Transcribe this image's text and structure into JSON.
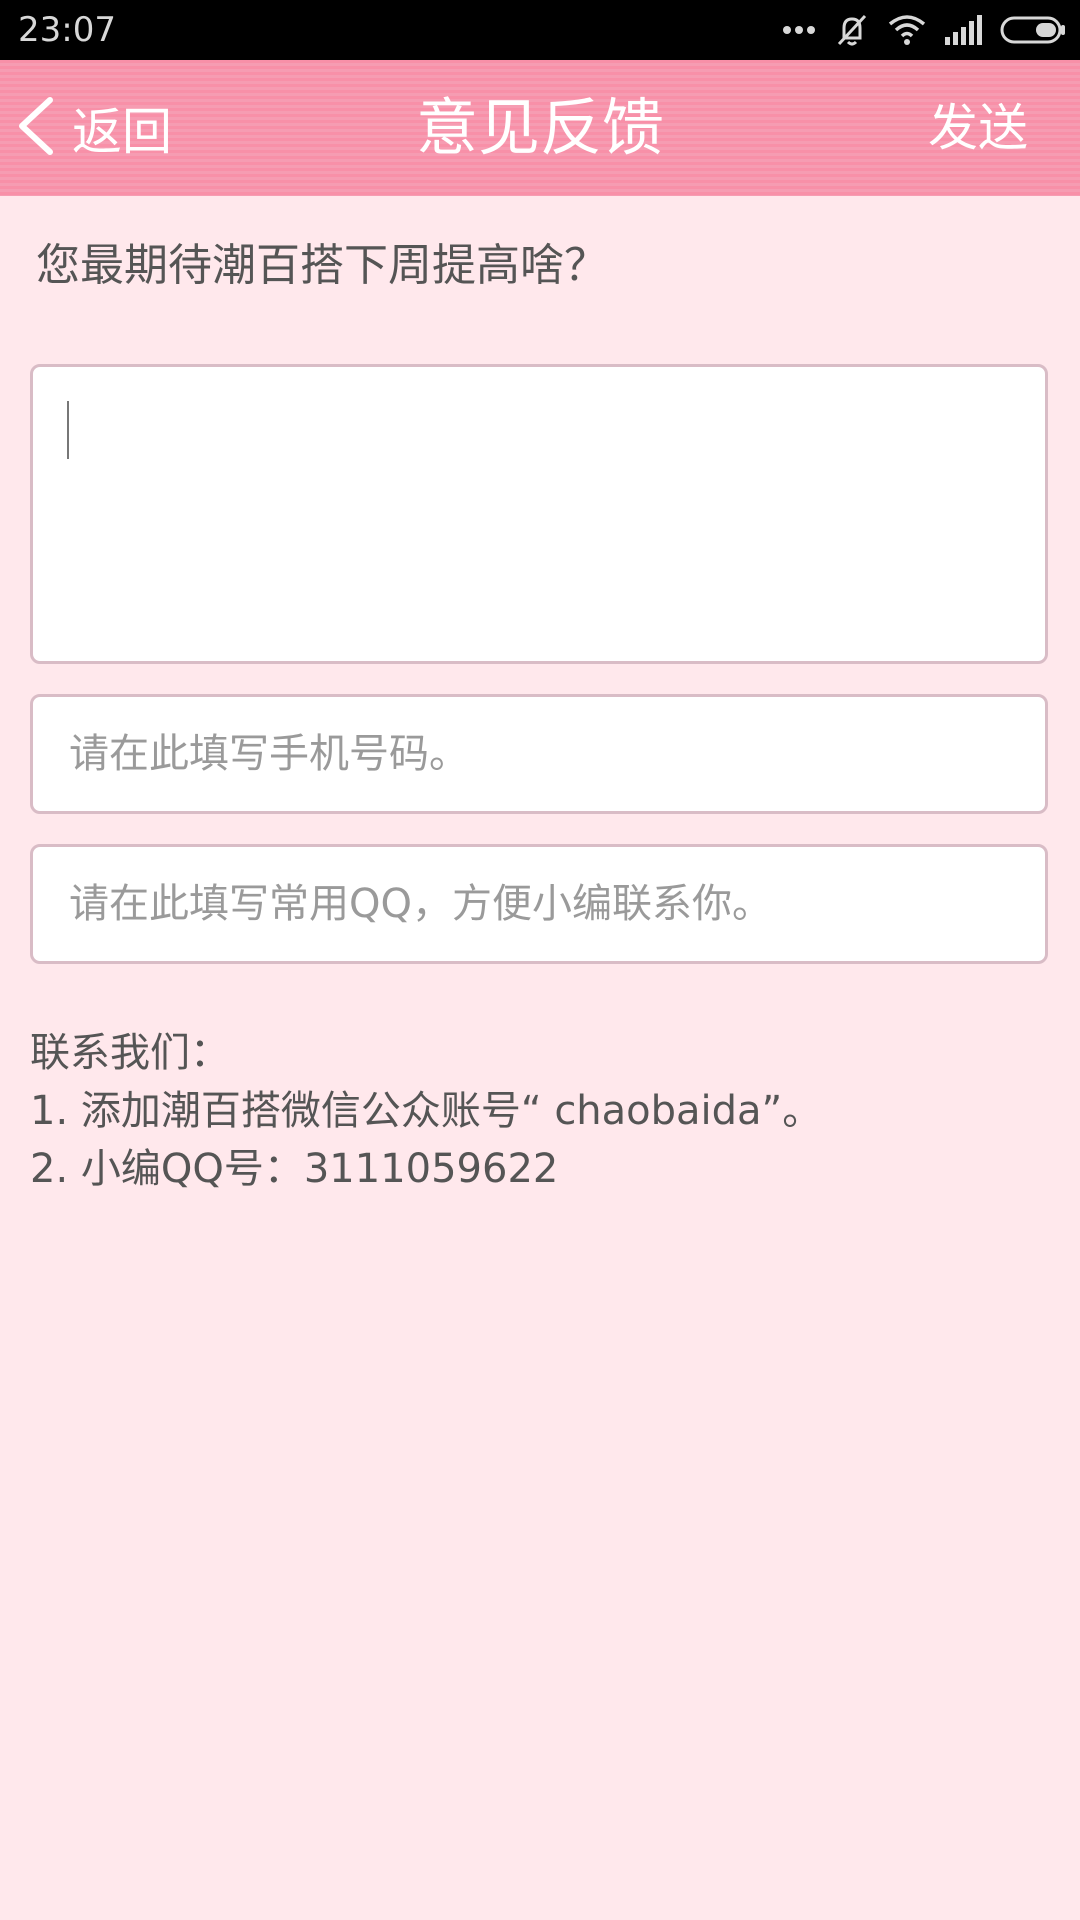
{
  "status_bar": {
    "time": "23:07",
    "icons": [
      "more-dots-icon",
      "vibrate-off-icon",
      "wifi-icon",
      "signal-icon",
      "battery-icon"
    ]
  },
  "header": {
    "back_label": "返回",
    "title": "意见反馈",
    "send_label": "发送"
  },
  "form": {
    "question": "您最期待潮百搭下周提高啥？",
    "feedback_value": "",
    "phone_placeholder": "请在此填写手机号码。",
    "qq_placeholder": "请在此填写常用QQ，方便小编联系你。"
  },
  "contact": {
    "heading": "联系我们：",
    "lines": [
      "1. 添加潮百搭微信公众账号“ chaobaida”。",
      "2. 小编QQ号：3111059622"
    ]
  },
  "colors": {
    "header_pink": "#f890a8",
    "background": "#ffe8ec",
    "field_border": "#d9bcc6"
  }
}
